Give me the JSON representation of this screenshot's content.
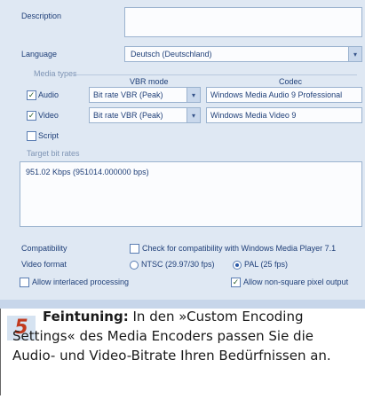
{
  "dialog": {
    "description_label": "Description",
    "description_value": "",
    "language_label": "Language",
    "language_value": "Deutsch (Deutschland)",
    "media_types_label": "Media types",
    "vbr_mode_header": "VBR mode",
    "codec_header": "Codec",
    "audio": {
      "label": "Audio",
      "checked": true,
      "vbr_mode": "Bit rate VBR (Peak)",
      "codec": "Windows Media Audio 9 Professional"
    },
    "video": {
      "label": "Video",
      "checked": true,
      "vbr_mode": "Bit rate VBR (Peak)",
      "codec": "Windows Media Video 9"
    },
    "script": {
      "label": "Script",
      "checked": false
    },
    "target_bit_rates_label": "Target bit rates",
    "target_bit_rates_value": "951.02 Kbps (951014.000000 bps)",
    "compatibility_label": "Compatibility",
    "compatibility_check_label": "Check for compatibility with Windows Media Player 7.1",
    "compatibility_checked": false,
    "video_format_label": "Video format",
    "video_format_options": [
      "NTSC (29.97/30 fps)",
      "PAL (25 fps)"
    ],
    "video_format_selected": "PAL (25 fps)",
    "interlace_label": "Allow interlaced processing",
    "interlace_checked": false,
    "nonsquare_label": "Allow non-square pixel output",
    "nonsquare_checked": true,
    "check_glyph": "✓",
    "arrow_glyph": "▾"
  },
  "caption": {
    "number": "5",
    "heading": "Feintuning:",
    "text": "In den »Custom Encoding Settings« des Media Encoders passen Sie die Audio- und Video-Bitrate Ihren Bedürfnissen an."
  }
}
